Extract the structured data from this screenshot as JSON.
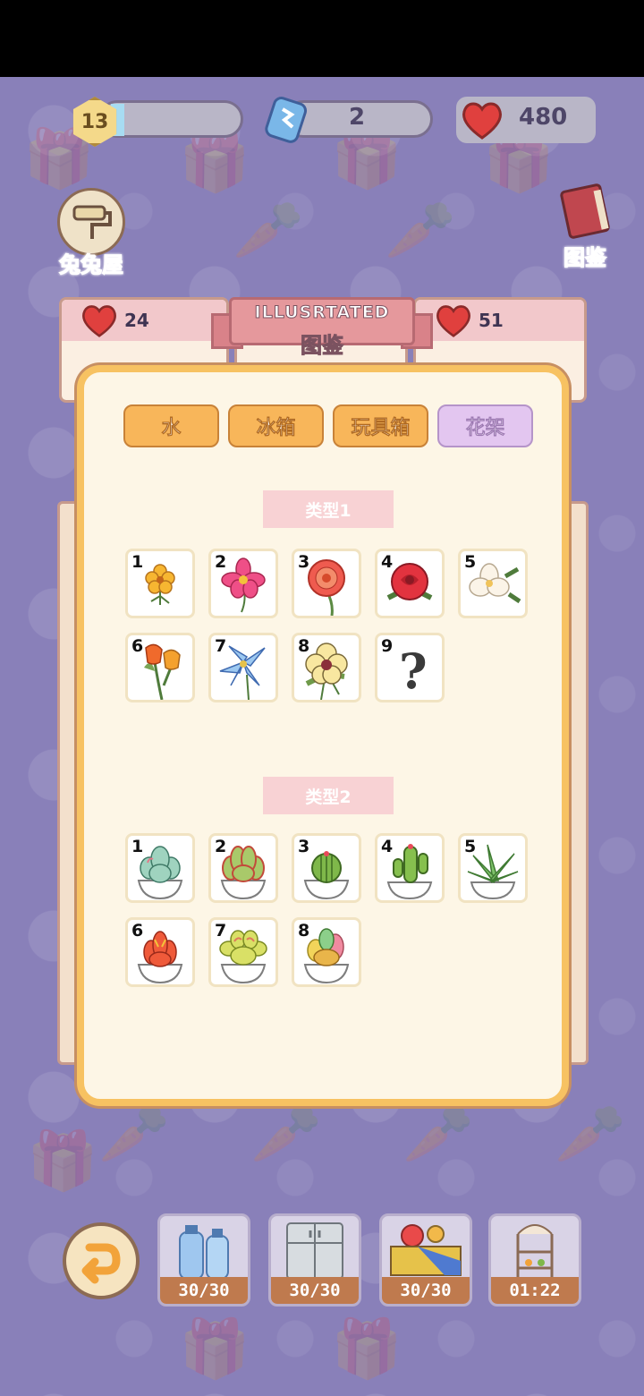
{
  "hud": {
    "level": "13",
    "level_progress": 0.1,
    "tickets": "2",
    "hearts": "480"
  },
  "side_buttons": {
    "left_label": "兔兔屋",
    "right_label": "图鉴"
  },
  "background_cards": [
    {
      "hearts": "24"
    },
    {
      "hearts": "51"
    }
  ],
  "ribbon": {
    "title_en": "ILLUSRTATED",
    "title_cn": "图鉴"
  },
  "tabs": [
    {
      "label": "水",
      "active": false
    },
    {
      "label": "冰箱",
      "active": false
    },
    {
      "label": "玩具箱",
      "active": false
    },
    {
      "label": "花架",
      "active": true
    }
  ],
  "sections": [
    {
      "title": "类型1",
      "items": [
        {
          "num": "1",
          "icon": "yellow-flower"
        },
        {
          "num": "2",
          "icon": "pink-cosmos"
        },
        {
          "num": "3",
          "icon": "red-gerbera"
        },
        {
          "num": "4",
          "icon": "red-rose"
        },
        {
          "num": "5",
          "icon": "white-magnolia"
        },
        {
          "num": "6",
          "icon": "orange-tulips"
        },
        {
          "num": "7",
          "icon": "blue-lily"
        },
        {
          "num": "8",
          "icon": "yellow-anemone"
        },
        {
          "num": "9",
          "icon": "locked-question-mark",
          "locked": true,
          "symbol": "?"
        }
      ]
    },
    {
      "title": "类型2",
      "items": [
        {
          "num": "1",
          "icon": "blue-echeveria"
        },
        {
          "num": "2",
          "icon": "red-echeveria"
        },
        {
          "num": "3",
          "icon": "round-cactus"
        },
        {
          "num": "4",
          "icon": "tall-cactus"
        },
        {
          "num": "5",
          "icon": "aloe"
        },
        {
          "num": "6",
          "icon": "red-succulent"
        },
        {
          "num": "7",
          "icon": "yellow-succulent"
        },
        {
          "num": "8",
          "icon": "mixed-succulent"
        }
      ]
    }
  ],
  "bottom_slots": [
    {
      "icon": "water-bottles",
      "caption": "30/30"
    },
    {
      "icon": "fridge",
      "caption": "30/30"
    },
    {
      "icon": "toy-box",
      "caption": "30/30"
    },
    {
      "icon": "flower-shelf",
      "caption": "01:22"
    }
  ],
  "colors": {
    "background": "#8980b9",
    "panel": "#fdf6e6",
    "panel_border": "#f7c262",
    "tab": "#f8b65a",
    "tab_active": "#e3c6f0",
    "section_label": "#f8d2d4"
  }
}
